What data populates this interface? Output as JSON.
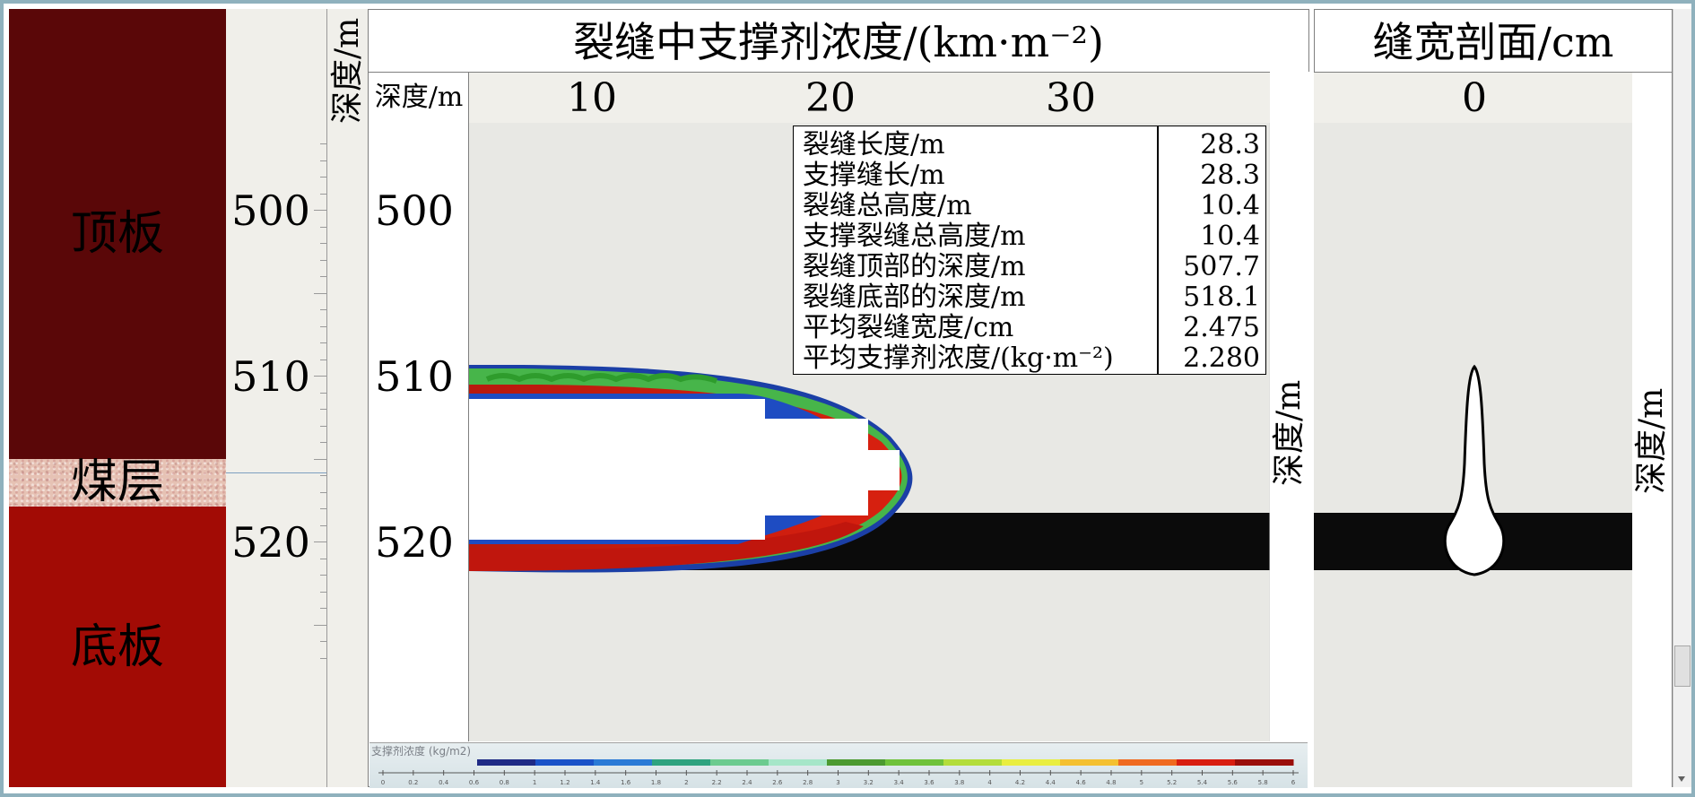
{
  "strata": [
    {
      "name": "顶板",
      "top": 499.5,
      "bottom": 515,
      "color": "#5a0708"
    },
    {
      "name": "煤层",
      "top": 515,
      "bottom": 517.9,
      "color": "#e6c2b4"
    },
    {
      "name": "底板",
      "top": 517.9,
      "bottom": 528,
      "color": "#a20b05"
    }
  ],
  "depth_ticks": [
    "500",
    "510",
    "520"
  ],
  "axis_labels": {
    "depth_vertical": "深度/m",
    "depth_corner": "深度/m"
  },
  "chart_data": [
    {
      "type": "heatmap",
      "title": "裂缝中支撑剂浓度/(km·m⁻²)",
      "xlabel": "裂缝中支撑剂浓度/(km·m⁻²)",
      "ylabel": "深度/m",
      "x_ticks": [
        "10",
        "20",
        "30"
      ],
      "y_ticks": [
        "500",
        "510",
        "520"
      ],
      "xlim": [
        5.5,
        38
      ],
      "ylim": [
        495.8,
        527.5
      ],
      "annotations_table": [
        {
          "label": "裂缝长度/m",
          "value": "28.3"
        },
        {
          "label": "支撑缝长/m",
          "value": "28.3"
        },
        {
          "label": "裂缝总高度/m",
          "value": "10.4"
        },
        {
          "label": "支撑裂缝总高度/m",
          "value": "10.4"
        },
        {
          "label": "裂缝顶部的深度/m",
          "value": "507.7"
        },
        {
          "label": "裂缝底部的深度/m",
          "value": "518.1"
        },
        {
          "label": "平均裂缝宽度/cm",
          "value": "2.475"
        },
        {
          "label": "平均支撑剂浓度/(kg·m⁻²)",
          "value": "2.280"
        }
      ],
      "fracture": {
        "top_depth": 507.7,
        "bottom_depth": 518.1,
        "tip_length": 28.3
      },
      "coal_seam": {
        "top": 515,
        "bottom": 517.9
      },
      "right_axis_label": "深度/m"
    },
    {
      "type": "area",
      "title": "缝宽剖面/cm",
      "xlabel": "缝宽剖面/cm",
      "ylabel": "深度/m",
      "x_ticks": [
        "0"
      ],
      "ylim": [
        495.8,
        527.5
      ],
      "profile_top": 507.7,
      "profile_bottom": 518.1
    }
  ],
  "legend": {
    "title": "支撑剂浓度 (kg/m2)",
    "colors": [
      "#1f2a85",
      "#1a52c8",
      "#2a7ad6",
      "#2fa37f",
      "#6ccb8f",
      "#a6e6c8",
      "#4c9a30",
      "#6fc23a",
      "#b3dd3a",
      "#e9ee40",
      "#f4c030",
      "#ef6a20",
      "#d81e10",
      "#9a0e0a"
    ],
    "tick_labels": [
      "0",
      "0.2",
      "0.4",
      "0.6",
      "0.8",
      "1",
      "1.2",
      "1.4",
      "1.6",
      "1.8",
      "2",
      "2.2",
      "2.4",
      "2.6",
      "2.8",
      "3",
      "3.2",
      "3.4",
      "3.6",
      "3.8",
      "4",
      "4.2",
      "4.4",
      "4.6",
      "4.8",
      "5",
      "5.2",
      "5.4",
      "5.6",
      "5.8",
      "6"
    ]
  }
}
